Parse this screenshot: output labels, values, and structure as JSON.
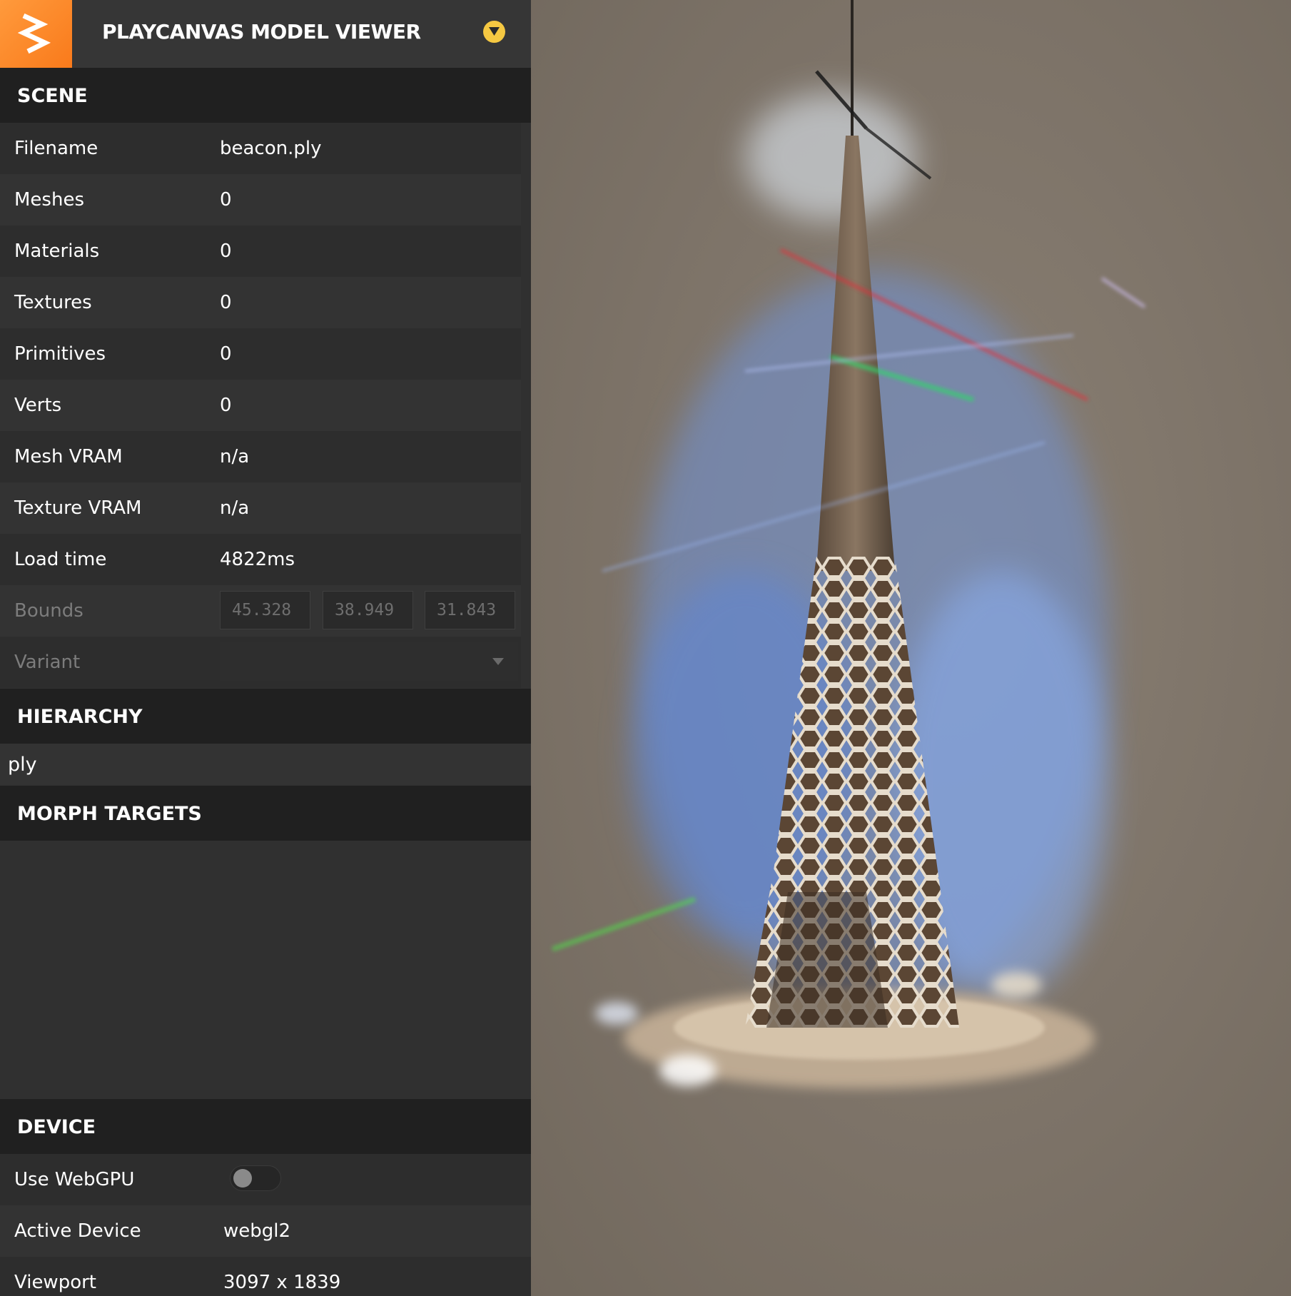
{
  "header": {
    "title": "PLAYCANVAS MODEL VIEWER"
  },
  "sections": {
    "scene": "SCENE",
    "hierarchy": "HIERARCHY",
    "morph_targets": "MORPH TARGETS",
    "device": "DEVICE"
  },
  "scene": {
    "filename": {
      "label": "Filename",
      "value": "beacon.ply"
    },
    "meshes": {
      "label": "Meshes",
      "value": "0"
    },
    "materials": {
      "label": "Materials",
      "value": "0"
    },
    "textures": {
      "label": "Textures",
      "value": "0"
    },
    "primitives": {
      "label": "Primitives",
      "value": "0"
    },
    "verts": {
      "label": "Verts",
      "value": "0"
    },
    "mesh_vram": {
      "label": "Mesh VRAM",
      "value": "n/a"
    },
    "texture_vram": {
      "label": "Texture VRAM",
      "value": "n/a"
    },
    "load_time": {
      "label": "Load time",
      "value": "4822ms"
    },
    "bounds": {
      "label": "Bounds",
      "x": "45.328",
      "y": "38.949",
      "z": "31.843"
    },
    "variant": {
      "label": "Variant",
      "value": ""
    }
  },
  "hierarchy": {
    "items": [
      "ply"
    ]
  },
  "device": {
    "use_webgpu": {
      "label": "Use WebGPU",
      "enabled": false
    },
    "active_device": {
      "label": "Active Device",
      "value": "webgl2"
    },
    "viewport": {
      "label": "Viewport",
      "value": "3097 x 1839"
    }
  },
  "icons": {
    "logo": "playcanvas-logo-icon",
    "menu": "chevron-down-icon",
    "variant_caret": "caret-down-icon"
  },
  "colors": {
    "logo_orange": "#f97a1b",
    "menu_button": "#f5c842",
    "panel_bg": "#303030",
    "header_bg": "#202020",
    "viewport_bg": "#7f7468"
  }
}
